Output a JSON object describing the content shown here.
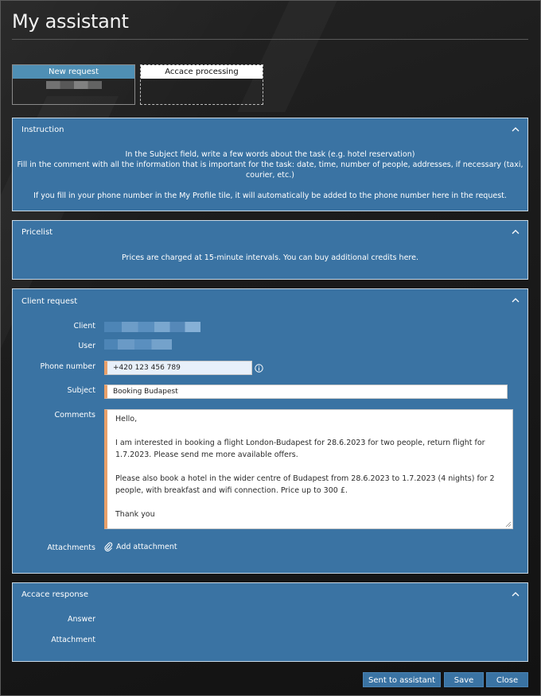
{
  "page": {
    "title": "My assistant"
  },
  "tiles": [
    {
      "label": "New request",
      "active": true
    },
    {
      "label": "Accace processing",
      "active": false
    }
  ],
  "instruction": {
    "heading": "Instruction",
    "lines": [
      "In the Subject field, write a few words about the task (e.g. hotel reservation)",
      "Fill in the comment with all the information that is important for the task: date, time, number of people, addresses, if necessary (taxi, courier, etc.)",
      "",
      "If you fill in your phone number in the My Profile tile, it will automatically be added to the phone number here in the request."
    ]
  },
  "pricelist": {
    "heading": "Pricelist",
    "text": "Prices are charged at 15-minute intervals. You can buy additional credits here."
  },
  "client_request": {
    "heading": "Client request",
    "client_label": "Client",
    "user_label": "User",
    "phone_label": "Phone number",
    "phone_value": "+420 123 456 789",
    "subject_label": "Subject",
    "subject_value": "Booking Budapest",
    "comments_label": "Comments",
    "comments_value": "Hello,\n\nI am interested in booking a flight London-Budapest for 28.6.2023 for two people, return flight for 1.7.2023. Please send me more available offers.\n\nPlease also book a hotel in the wider centre of Budapest from 28.6.2023 to 1.7.2023 (4 nights) for 2 people, with breakfast and wifi connection. Price up to 300 £.\n\nThank you",
    "attachments_label": "Attachments",
    "add_attachment_label": "Add attachment"
  },
  "response": {
    "heading": "Accace response",
    "answer_label": "Answer",
    "attachment_label": "Attachment"
  },
  "buttons": {
    "send": "Sent to assistant",
    "save": "Save",
    "close": "Close"
  },
  "colors": {
    "panel": "#3a73a3",
    "tile_active": "#4f8fb4",
    "input_accent": "#e8a06a"
  }
}
